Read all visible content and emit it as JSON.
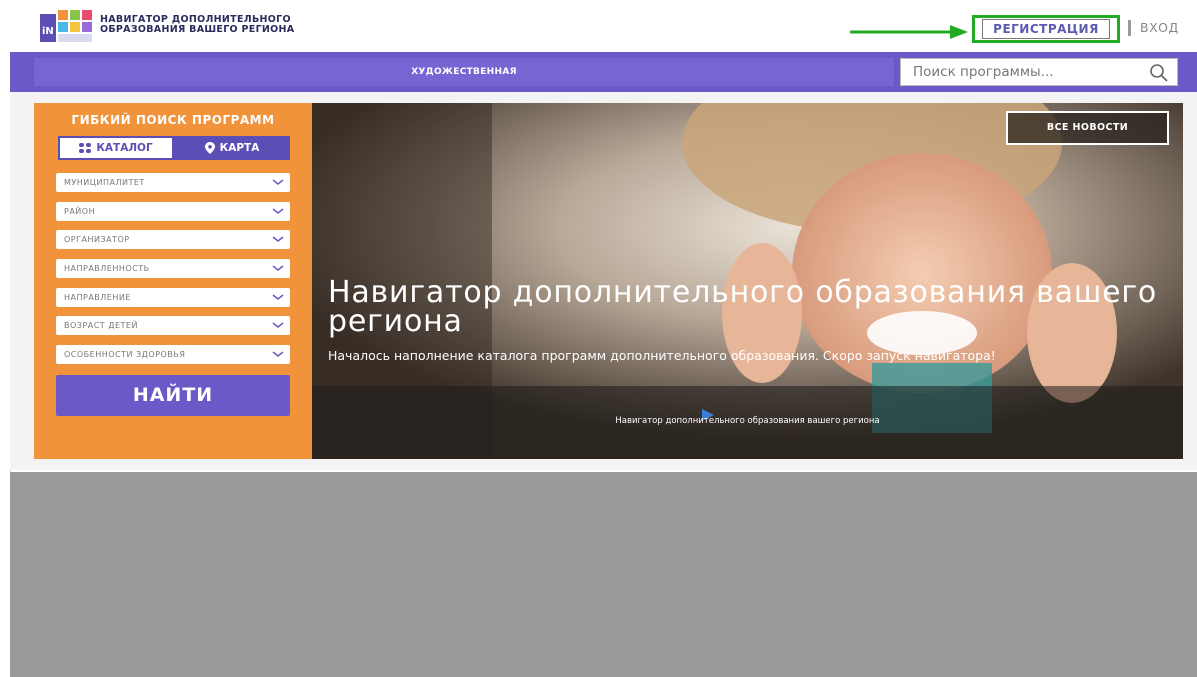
{
  "header": {
    "logo_title_line1": "НАВИГАТОР ДОПОЛНИТЕЛЬНОГО",
    "logo_title_line2": "ОБРАЗОВАНИЯ ВАШЕГО РЕГИОНА",
    "register_label": "РЕГИСТРАЦИЯ",
    "login_label": "ВХОД"
  },
  "nav": {
    "category_label": "ХУДОЖЕСТВЕННАЯ",
    "search_placeholder": "Поиск программы..."
  },
  "filter": {
    "title": "ГИБКИЙ ПОИСК ПРОГРАММ",
    "tab_catalog": "КАТАЛОГ",
    "tab_map": "КАРТА",
    "selects": [
      "МУНИЦИПАЛИТЕТ",
      "РАЙОН",
      "ОРГАНИЗАТОР",
      "НАПРАВЛЕННОСТЬ",
      "НАПРАВЛЕНИЕ",
      "ВОЗРАСТ ДЕТЕЙ",
      "ОСОБЕННОСТИ ЗДОРОВЬЯ"
    ],
    "find_label": "НАЙТИ"
  },
  "hero": {
    "all_news_label": "ВСЕ НОВОСТИ",
    "title": "Навигатор дополнительного образования вашего региона",
    "subtitle": "Началось наполнение каталога программ дополнительного образования. Скоро запуск навигатора!",
    "caption": "Навигатор дополнительного образования вашего региона"
  },
  "colors": {
    "accent_purple": "#6a59c7",
    "filter_orange": "#f0933a",
    "highlight_green": "#22aa22"
  }
}
